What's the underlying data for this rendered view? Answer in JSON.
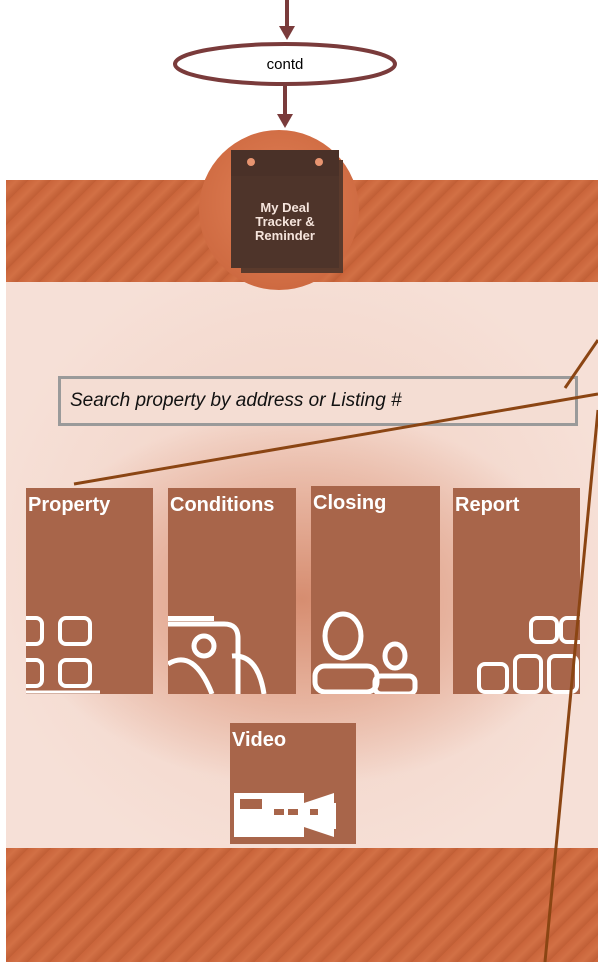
{
  "flow": {
    "connector_label": "contd"
  },
  "app": {
    "logo_text": "My Deal\nTracker &\nReminder",
    "logo_icon": "calendar-icon",
    "search": {
      "placeholder": "Search property by address or Listing #"
    },
    "tiles": [
      {
        "label": "Property",
        "icon": "grid-icon"
      },
      {
        "label": "Conditions",
        "icon": "document-photo-icon"
      },
      {
        "label": "Closing",
        "icon": "people-icon"
      },
      {
        "label": "Report",
        "icon": "grid-icon"
      },
      {
        "label": "Video",
        "icon": "video-camera-icon"
      }
    ]
  },
  "colors": {
    "tile_bg": "#a8654a",
    "band": "#c9643a",
    "logo_circle": "#cf6b42",
    "connector": "#7a3b3b",
    "annotation_line": "#8b4513"
  }
}
